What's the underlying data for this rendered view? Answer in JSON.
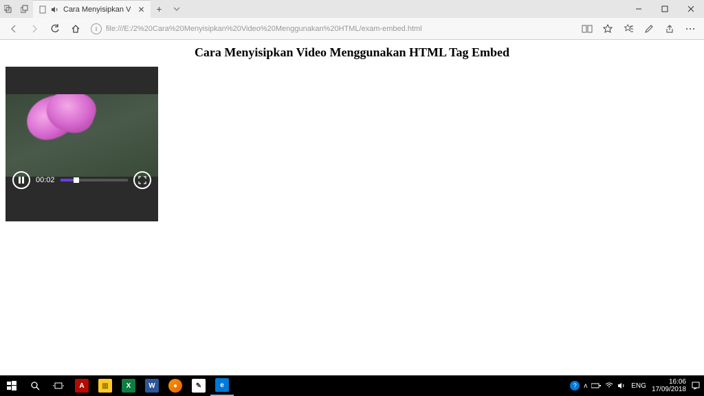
{
  "titlebar": {
    "tab_title": "Cara Menyisipkan V"
  },
  "toolbar": {
    "url": "file:///E:/2%20Cara%20Menyisipkan%20Video%20Menggunakan%20HTML/exam-embed.html"
  },
  "page": {
    "heading": "Cara Menyisipkan Video Menggunakan HTML Tag Embed",
    "video": {
      "time": "00:02"
    }
  },
  "tray": {
    "lang": "ENG",
    "time": "16:06",
    "date": "17/09/2018"
  }
}
